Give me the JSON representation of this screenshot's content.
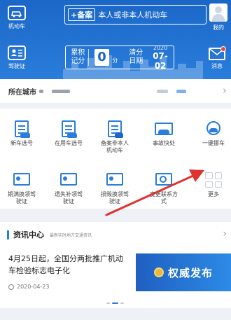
{
  "header": {
    "motor_label": "机动车",
    "mine_label": "我的",
    "license_label": "驾驶证",
    "message_label": "消息",
    "plate_tag": "+备案",
    "plate_text": "本人或非本人机动车",
    "score_label": "累积记分",
    "score_value": "0",
    "score_unit": "分",
    "clear_label": "清分日期",
    "clear_year": "2020",
    "clear_md": "07-02"
  },
  "city": {
    "label": "所在城市"
  },
  "services": [
    {
      "label": "新车选号",
      "icon": "new-car-icon"
    },
    {
      "label": "在用车选号",
      "icon": "used-car-icon"
    },
    {
      "label": "备案非本人机动车",
      "icon": "register-car-icon"
    },
    {
      "label": "事故快处",
      "icon": "accident-icon"
    },
    {
      "label": "一键挪车",
      "icon": "move-car-icon"
    },
    {
      "label": "期满换领驾驶证",
      "icon": "renew-license-icon"
    },
    {
      "label": "遗失补领驾驶证",
      "icon": "reissue-license-icon"
    },
    {
      "label": "损毁换领驾驶证",
      "icon": "replace-license-icon"
    },
    {
      "label": "变更联系方式",
      "icon": "contact-change-icon"
    },
    {
      "label": "更多",
      "icon": "more-grid-icon"
    }
  ],
  "news": {
    "title": "资讯中心",
    "subtitle": "最新实时地方交通资讯",
    "headline": "4月25日起，全国分两批推广机动车检验标志电子化",
    "date": "2020-04-23",
    "banner_text": "权威发布"
  },
  "colors": {
    "primary": "#2a7ddb",
    "header_dark": "#1b67c8",
    "arrow": "#e0322e"
  }
}
